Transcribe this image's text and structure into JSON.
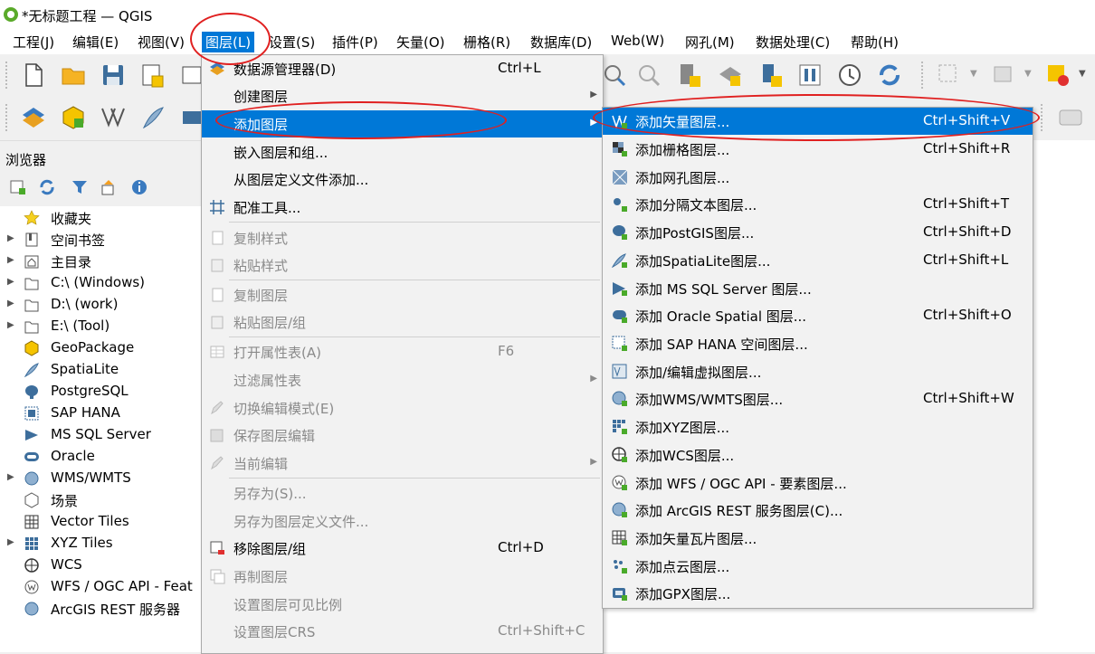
{
  "window": {
    "title": "*无标题工程 — QGIS"
  },
  "menubar": [
    "工程(J)",
    "编辑(E)",
    "视图(V)",
    "图层(L)",
    "设置(S)",
    "插件(P)",
    "矢量(O)",
    "栅格(R)",
    "数据库(D)",
    "Web(W)",
    "网孔(M)",
    "数据处理(C)",
    "帮助(H)"
  ],
  "browser": {
    "title": "浏览器",
    "items": [
      "收藏夹",
      "空间书签",
      "主目录",
      "C:\\ (Windows)",
      "D:\\ (work)",
      "E:\\ (Tool)",
      "GeoPackage",
      "SpatiaLite",
      "PostgreSQL",
      "SAP HANA",
      "MS SQL Server",
      "Oracle",
      "WMS/WMTS",
      "场景",
      "Vector Tiles",
      "XYZ Tiles",
      "WCS",
      "WFS / OGC API - Feat",
      "ArcGIS REST 服务器"
    ]
  },
  "layer_menu": [
    {
      "label": "数据源管理器(D)",
      "shortcut": "Ctrl+L"
    },
    {
      "label": "创建图层",
      "shortcut": ""
    },
    {
      "label": "添加图层",
      "shortcut": ""
    },
    {
      "label": "嵌入图层和组...",
      "shortcut": ""
    },
    {
      "label": "从图层定义文件添加...",
      "shortcut": ""
    },
    {
      "label": "配准工具...",
      "shortcut": ""
    },
    {
      "label": "复制样式",
      "shortcut": ""
    },
    {
      "label": "粘贴样式",
      "shortcut": ""
    },
    {
      "label": "复制图层",
      "shortcut": ""
    },
    {
      "label": "粘贴图层/组",
      "shortcut": ""
    },
    {
      "label": "打开属性表(A)",
      "shortcut": "F6"
    },
    {
      "label": "过滤属性表",
      "shortcut": ""
    },
    {
      "label": "切换编辑模式(E)",
      "shortcut": ""
    },
    {
      "label": "保存图层编辑",
      "shortcut": ""
    },
    {
      "label": "当前编辑",
      "shortcut": ""
    },
    {
      "label": "另存为(S)...",
      "shortcut": ""
    },
    {
      "label": "另存为图层定义文件...",
      "shortcut": ""
    },
    {
      "label": "移除图层/组",
      "shortcut": "Ctrl+D"
    },
    {
      "label": "再制图层",
      "shortcut": ""
    },
    {
      "label": "设置图层可见比例",
      "shortcut": ""
    },
    {
      "label": "设置图层CRS",
      "shortcut": "Ctrl+Shift+C"
    }
  ],
  "add_layer_menu": [
    {
      "label": "添加矢量图层...",
      "shortcut": "Ctrl+Shift+V"
    },
    {
      "label": "添加栅格图层...",
      "shortcut": "Ctrl+Shift+R"
    },
    {
      "label": "添加网孔图层...",
      "shortcut": ""
    },
    {
      "label": "添加分隔文本图层...",
      "shortcut": "Ctrl+Shift+T"
    },
    {
      "label": "添加PostGIS图层...",
      "shortcut": "Ctrl+Shift+D"
    },
    {
      "label": "添加SpatiaLite图层...",
      "shortcut": "Ctrl+Shift+L"
    },
    {
      "label": "添加 MS SQL Server 图层...",
      "shortcut": ""
    },
    {
      "label": "添加 Oracle Spatial 图层...",
      "shortcut": "Ctrl+Shift+O"
    },
    {
      "label": "添加 SAP HANA 空间图层...",
      "shortcut": ""
    },
    {
      "label": "添加/编辑虚拟图层...",
      "shortcut": ""
    },
    {
      "label": "添加WMS/WMTS图层...",
      "shortcut": "Ctrl+Shift+W"
    },
    {
      "label": "添加XYZ图层...",
      "shortcut": ""
    },
    {
      "label": "添加WCS图层...",
      "shortcut": ""
    },
    {
      "label": "添加 WFS / OGC API - 要素图层...",
      "shortcut": ""
    },
    {
      "label": "添加 ArcGIS REST 服务图层(C)...",
      "shortcut": ""
    },
    {
      "label": "添加矢量瓦片图层...",
      "shortcut": ""
    },
    {
      "label": "添加点云图层...",
      "shortcut": ""
    },
    {
      "label": "添加GPX图层...",
      "shortcut": ""
    }
  ],
  "colors": {
    "highlight": "#0078d7",
    "annotation": "#e02020"
  }
}
